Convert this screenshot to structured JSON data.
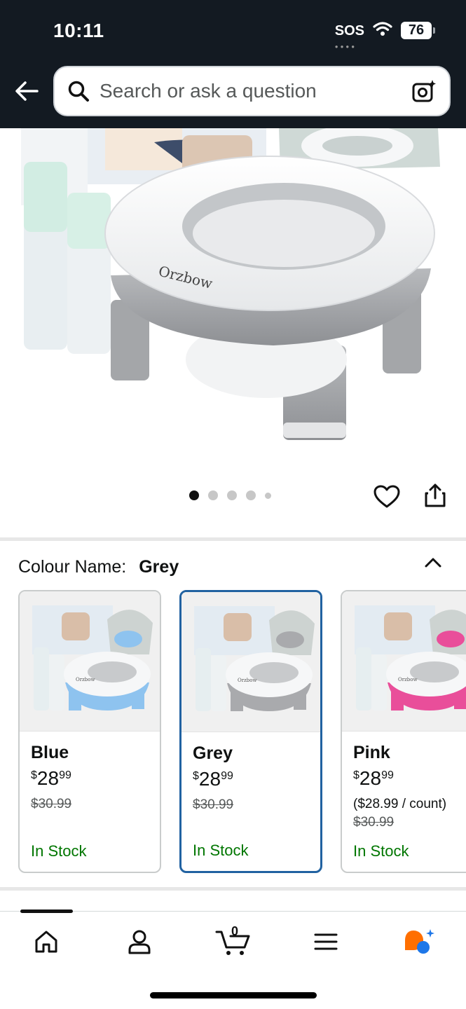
{
  "status_bar": {
    "time": "10:11",
    "sos": "SOS",
    "battery": "76"
  },
  "search": {
    "placeholder": "Search or ask a question"
  },
  "hero": {
    "brand_logo": "Orzbow",
    "image_count": 5,
    "active_index": 0
  },
  "variation": {
    "label": "Colour Name:",
    "selected": "Grey"
  },
  "swatches": [
    {
      "name": "Blue",
      "currency": "$",
      "price_whole": "28",
      "price_cents": "99",
      "was_price": "$30.99",
      "unit_price": "",
      "stock": "In Stock",
      "color": "#8ec3ef",
      "selected": false
    },
    {
      "name": "Grey",
      "currency": "$",
      "price_whole": "28",
      "price_cents": "99",
      "was_price": "$30.99",
      "unit_price": "",
      "stock": "In Stock",
      "color": "#a9aaad",
      "selected": true
    },
    {
      "name": "Pink",
      "currency": "$",
      "price_whole": "28",
      "price_cents": "99",
      "was_price": "$30.99",
      "unit_price": "($28.99 / count)",
      "stock": "In Stock",
      "color": "#e94e9a",
      "selected": false
    }
  ],
  "bottom_nav": {
    "items": [
      "home-icon",
      "account-icon",
      "cart-icon",
      "menu-icon",
      "rufus-icon"
    ],
    "cart_count": "0"
  },
  "colors": {
    "header_bg": "#131a22",
    "selected_border": "#2162a1",
    "in_stock": "#007600"
  }
}
